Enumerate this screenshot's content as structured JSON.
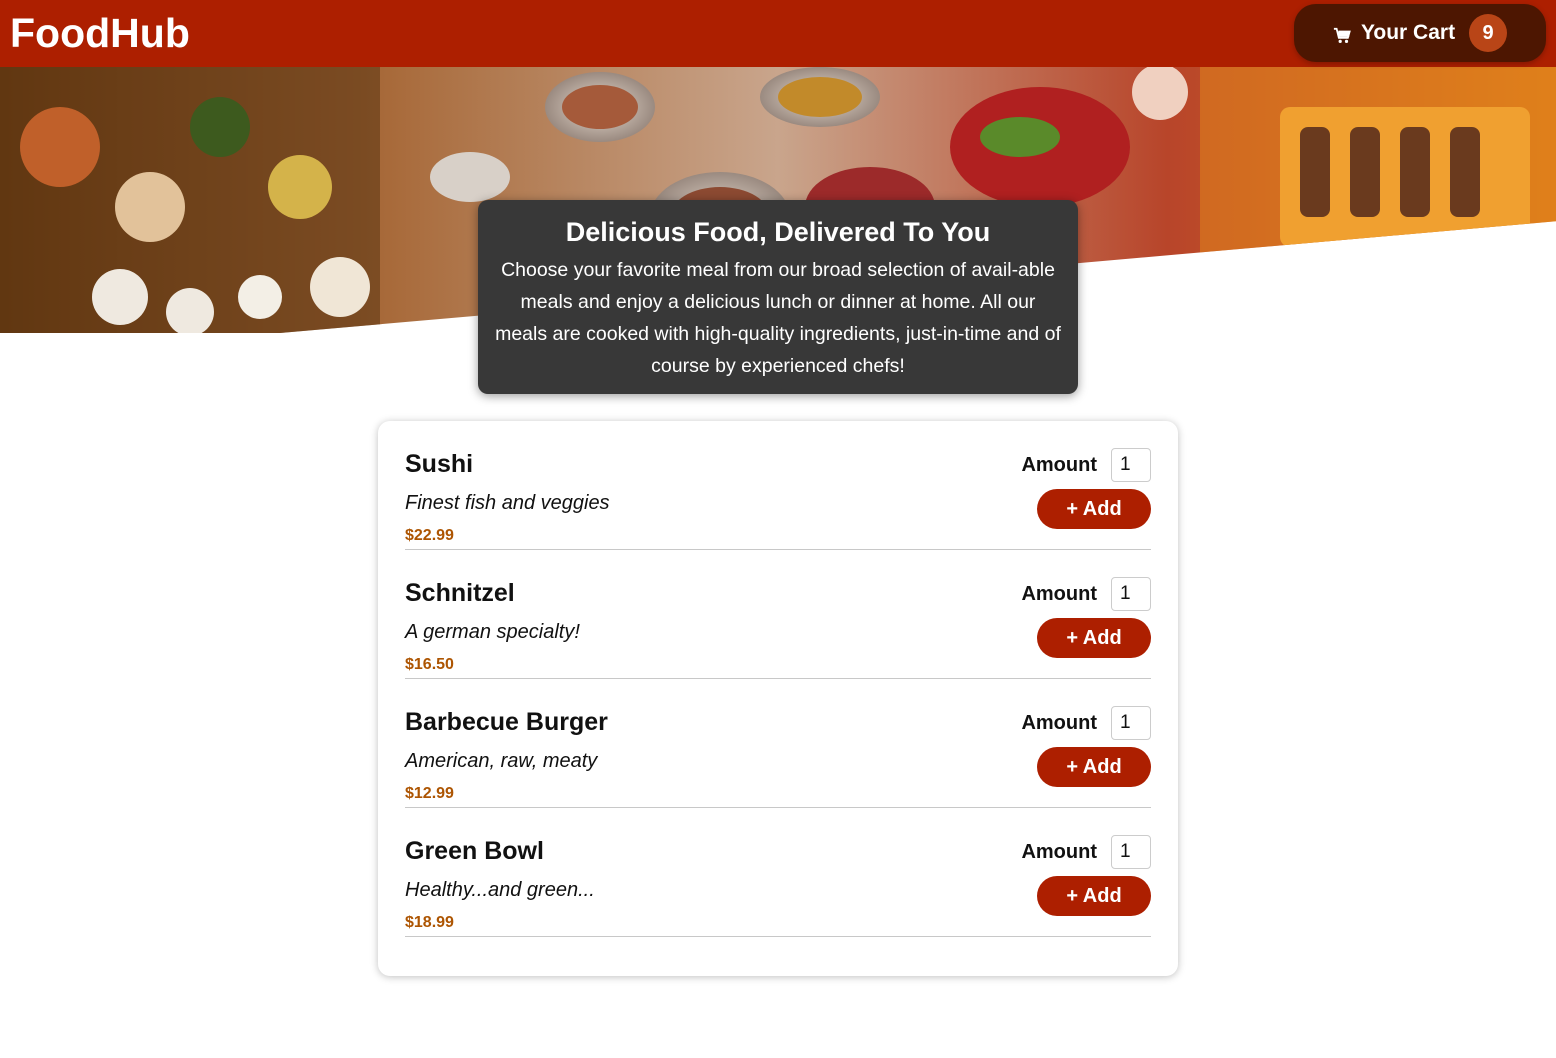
{
  "header": {
    "logo": "FoodHub",
    "cart_label": "Your Cart",
    "cart_count": "9",
    "cart_icon": "cart-icon"
  },
  "summary": {
    "title": "Delicious Food, Delivered To You",
    "text": "Choose your favorite meal from our broad selection of avail-able meals and enjoy a delicious lunch or dinner at home. All our meals are cooked with high-quality ingredients, just-in-time and of course by experienced chefs!"
  },
  "meals": [
    {
      "name": "Sushi",
      "description": "Finest fish and veggies",
      "price": "$22.99",
      "amount_label": "Amount",
      "amount": "1",
      "add_label": "+ Add"
    },
    {
      "name": "Schnitzel",
      "description": "A german specialty!",
      "price": "$16.50",
      "amount_label": "Amount",
      "amount": "1",
      "add_label": "+ Add"
    },
    {
      "name": "Barbecue Burger",
      "description": "American, raw, meaty",
      "price": "$12.99",
      "amount_label": "Amount",
      "amount": "1",
      "add_label": "+ Add"
    },
    {
      "name": "Green Bowl",
      "description": "Healthy...and green...",
      "price": "$18.99",
      "amount_label": "Amount",
      "amount": "1",
      "add_label": "+ Add"
    }
  ],
  "colors": {
    "header": "#ad1f00",
    "cart_button": "#4d1601",
    "cart_badge": "#b94517",
    "add_button": "#ad1f00",
    "price": "#ad5502",
    "summary_bg": "#383838"
  }
}
